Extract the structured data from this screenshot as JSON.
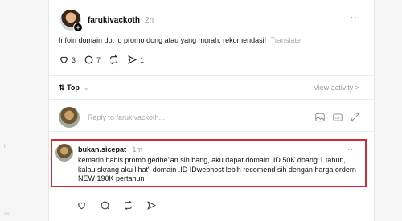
{
  "ghost": {
    "a": "it",
    "b": "as"
  },
  "post": {
    "username": "farukivackoth",
    "time": "2h",
    "more": "···",
    "text": "Infoin domain dot id promo dong atau yang murah, rekomendasi!",
    "translate": "Translate",
    "likes": "3",
    "comments": "7",
    "shares": "1",
    "icons": [
      "heart-icon",
      "comment-icon",
      "repost-icon",
      "share-icon"
    ]
  },
  "sort": {
    "label": "Top",
    "arrow": "⇅",
    "chevron": "⌄"
  },
  "view_activity": "View activity >",
  "reply": {
    "placeholder": "Reply to farukivackoth...",
    "icons": [
      "image-icon",
      "gif-icon",
      "expand-icon"
    ]
  },
  "comment": {
    "username": "bukan.sicepat",
    "time": "1m",
    "more": "···",
    "text": "kemarin habis promo gedhe\"an sih bang, aku dapat domain .ID 50K doang 1 tahun, kalau skrang aku lihat\" domain .ID IDwebhost lebih recomend sih dengan harga ordern NEW 190K pertahun",
    "icons": [
      "heart-icon",
      "comment-icon",
      "repost-icon",
      "share-icon"
    ]
  },
  "colors": {
    "highlight": "#d42a35",
    "muted": "#999999"
  }
}
